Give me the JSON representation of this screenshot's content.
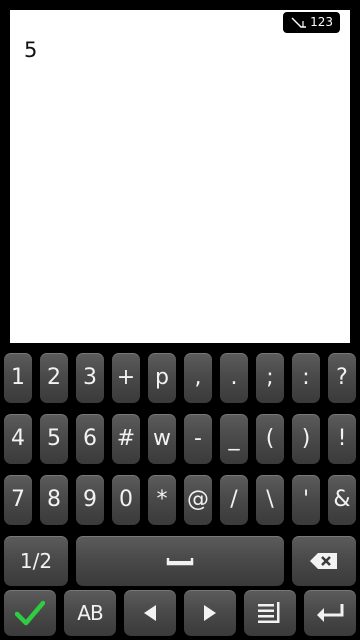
{
  "status": {
    "input_mode": "123",
    "indicator_icon": "pen-input-icon"
  },
  "editor": {
    "text": "5"
  },
  "keyboard": {
    "rows": [
      [
        "1",
        "2",
        "3",
        "+",
        "p",
        ",",
        ".",
        ";",
        ":",
        "?"
      ],
      [
        "4",
        "5",
        "6",
        "#",
        "w",
        "-",
        "_",
        "(",
        ")",
        "!"
      ],
      [
        "7",
        "8",
        "9",
        "0",
        "*",
        "@",
        "/",
        "\\",
        "'",
        "&"
      ]
    ],
    "page_toggle": "1/2",
    "space_icon": "space-bar-icon",
    "backspace_icon": "backspace-icon",
    "bottom": {
      "confirm_icon": "checkmark-icon",
      "case_label": "AB",
      "left_icon": "arrow-left-icon",
      "right_icon": "arrow-right-icon",
      "menu_icon": "menu-icon",
      "enter_icon": "enter-icon"
    },
    "colors": {
      "key": "#4a4a4a",
      "confirm_green": "#2ecc40",
      "background": "#000000"
    }
  }
}
